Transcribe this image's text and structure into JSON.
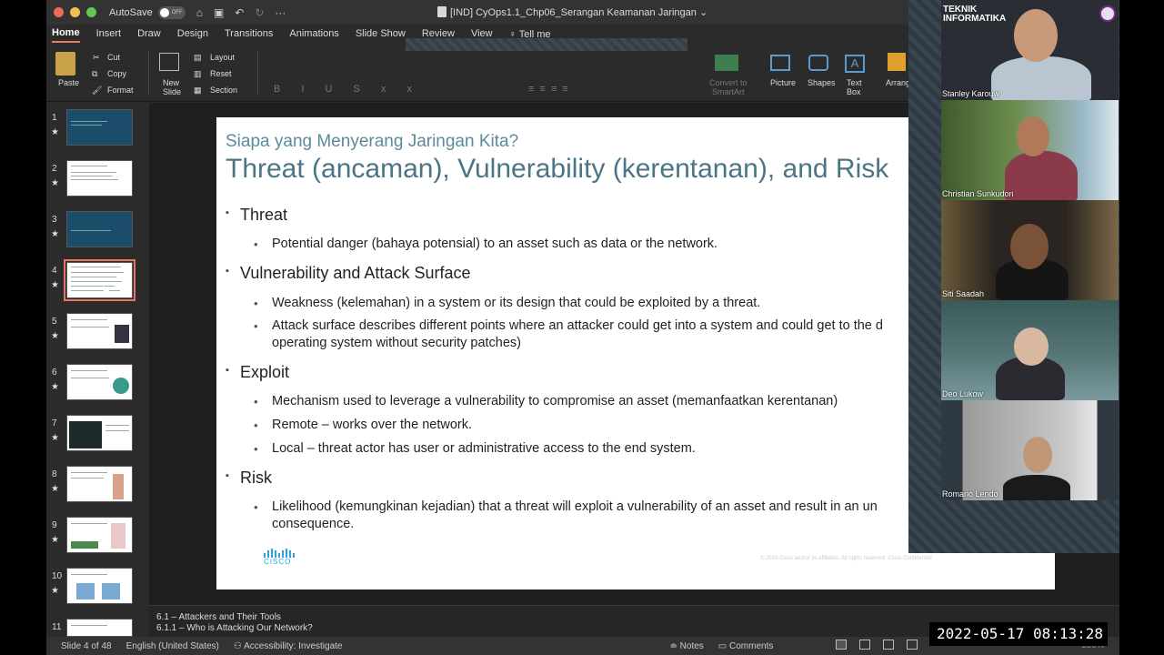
{
  "window": {
    "autosave_label": "AutoSave",
    "autosave_state": "OFF",
    "doc_title": "[IND] CyOps1.1_Chp06_Serangan Keamanan Jaringan",
    "traffic_colors": [
      "#ed6a5e",
      "#f5bf4f",
      "#62c554"
    ]
  },
  "tabs": [
    "Home",
    "Insert",
    "Draw",
    "Design",
    "Transitions",
    "Animations",
    "Slide Show",
    "Review",
    "View"
  ],
  "tell_me": "Tell me",
  "ribbon": {
    "paste": "Paste",
    "cut": "Cut",
    "copy": "Copy",
    "format": "Format",
    "new_slide": "New\nSlide",
    "layout": "Layout",
    "reset": "Reset",
    "section": "Section",
    "convert": "Convert to\nSmartArt",
    "picture": "Picture",
    "shapes": "Shapes",
    "textbox": "Text\nBox",
    "arrange": "Arrang"
  },
  "thumbnails": [
    {
      "num": "1",
      "star": "★",
      "dark": true
    },
    {
      "num": "2",
      "star": "★",
      "dark": false
    },
    {
      "num": "3",
      "star": "★",
      "dark": true
    },
    {
      "num": "4",
      "star": "★",
      "dark": false,
      "selected": true
    },
    {
      "num": "5",
      "star": "★",
      "dark": false
    },
    {
      "num": "6",
      "star": "★",
      "dark": false
    },
    {
      "num": "7",
      "star": "★",
      "dark": false
    },
    {
      "num": "8",
      "star": "★",
      "dark": false
    },
    {
      "num": "9",
      "star": "★",
      "dark": false
    },
    {
      "num": "10",
      "star": "★",
      "dark": false
    },
    {
      "num": "11",
      "star": "",
      "dark": false
    }
  ],
  "slide": {
    "subtitle": "Siapa yang Menyerang Jaringan Kita?",
    "title": "Threat (ancaman), Vulnerability (kerentanan), and Risk",
    "sections": [
      {
        "heading": "Threat",
        "items": [
          "Potential danger (bahaya potensial) to an asset such as data or the network."
        ]
      },
      {
        "heading": "Vulnerability and Attack Surface",
        "items": [
          "Weakness (kelemahan) in a system or its design that could be exploited by a threat.",
          "Attack surface describes different points where an attacker could get into a system and could get to the d",
          "operating system without security patches)"
        ]
      },
      {
        "heading": "Exploit",
        "items": [
          "Mechanism used to leverage a vulnerability to compromise an asset (memanfaatkan kerentanan)",
          "Remote – works over the network.",
          "Local – threat actor has user or administrative access to the end system."
        ]
      },
      {
        "heading": "Risk",
        "items": [
          "Likelihood (kemungkinan kejadian) that a threat will exploit a vulnerability of an asset and result in an un",
          "consequence."
        ]
      }
    ],
    "logo_text": "CISCO",
    "copyright": "© 2018  Cisco and/or its affiliates. All rights reserved.   Cisco Confidential"
  },
  "notes": [
    "6.1 – Attackers and Their Tools",
    "6.1.1 – Who is Attacking Our Network?"
  ],
  "status": {
    "slide_info": "Slide 4 of 48",
    "language": "English (United States)",
    "accessibility": "Accessibility: Investigate",
    "notes_btn": "Notes",
    "comments_btn": "Comments",
    "zoom": "156%"
  },
  "participants": [
    {
      "name": "Stanley Karouw",
      "banner": "TEKNIK\nINFORMATIKA"
    },
    {
      "name": "Christian Sunkudon"
    },
    {
      "name": "Siti Saadah"
    },
    {
      "name": "Deo Lukow"
    },
    {
      "name": "Romario Lendo"
    }
  ],
  "timestamp": "2022-05-17  08:13:28"
}
